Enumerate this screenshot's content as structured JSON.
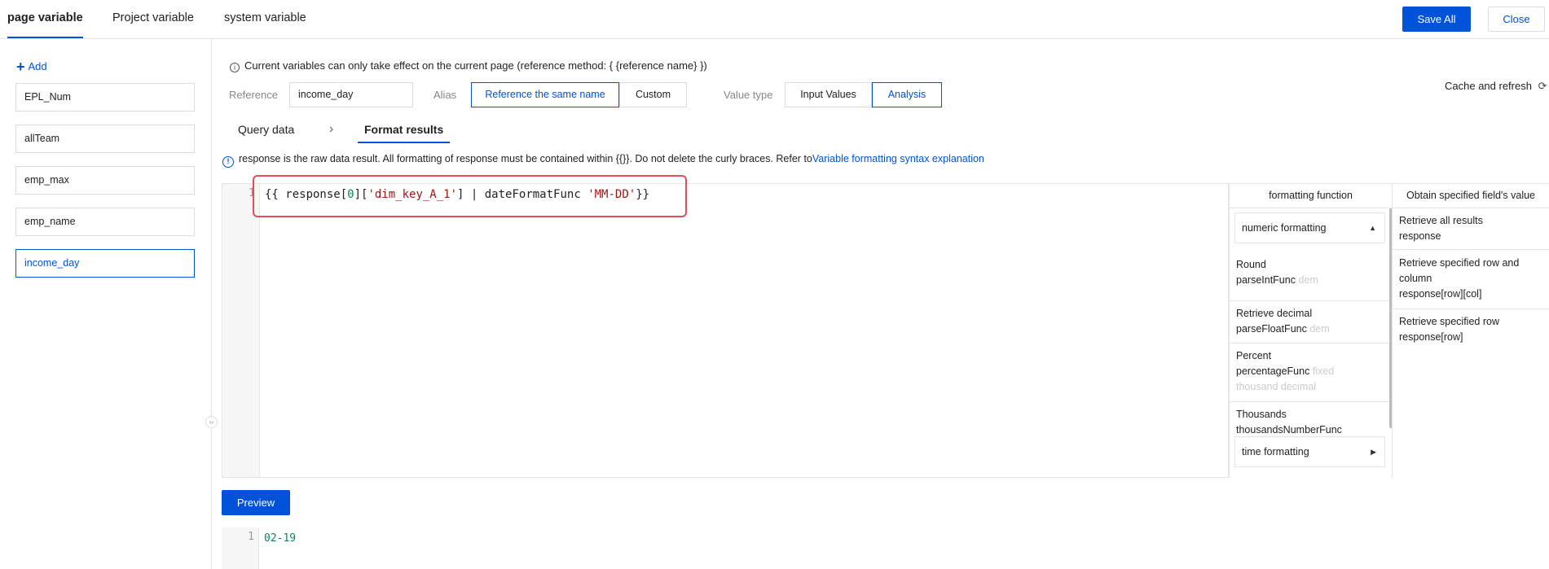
{
  "tabs": {
    "page": "page variable",
    "project": "Project variable",
    "system": "system variable"
  },
  "actions": {
    "save_all": "Save All",
    "close": "Close"
  },
  "sidebar": {
    "add_label": "Add",
    "variables": [
      "EPL_Num",
      "allTeam",
      "emp_max",
      "emp_name",
      "income_day"
    ],
    "selected": "income_day"
  },
  "info": "Current variables can only take effect on the current page (reference method: { {reference name} })",
  "form": {
    "reference_label": "Reference",
    "reference_value": "income_day",
    "alias_label": "Alias",
    "alias_options": [
      "Reference the same name",
      "Custom"
    ],
    "value_type_label": "Value type",
    "value_type_options": [
      "Input Values",
      "Analysis"
    ],
    "cache_refresh": "Cache and refresh"
  },
  "subtabs": {
    "query": "Query data",
    "format": "Format results"
  },
  "notice": {
    "text": "response is the raw data result. All formatting of response must be contained within {{}}. Do not delete the curly braces. Refer to",
    "link": "Variable formatting syntax explanation"
  },
  "editor": {
    "line_number": "1",
    "code": {
      "p1": "{{ response[",
      "n1": "0",
      "p2": "][",
      "s1": "'dim_key_A_1'",
      "p3": "] | dateFormatFunc ",
      "s2": "'MM-DD'",
      "p4": "}}"
    }
  },
  "format_panel": {
    "title": "formatting function",
    "numeric_dropdown": "numeric formatting",
    "time_dropdown": "time formatting",
    "functions": [
      {
        "name": "Round",
        "func": "parseIntFunc",
        "hint": "dem"
      },
      {
        "name": "Retrieve decimal",
        "func": "parseFloatFunc",
        "hint": "dem"
      },
      {
        "name": "Percent",
        "func": "percentageFunc",
        "hint": "fixed",
        "hint2": "thousand decimal"
      },
      {
        "name": "Thousands",
        "func": "thousandsNumberFunc",
        "hint": ""
      }
    ]
  },
  "value_panel": {
    "title": "Obtain specified field's value",
    "items": [
      {
        "l1": "Retrieve all results",
        "l2": "response"
      },
      {
        "l1": "Retrieve specified row and",
        "l2": "column",
        "l3": "response[row][col]"
      },
      {
        "l1": "Retrieve specified row",
        "l2": "response[row]"
      }
    ]
  },
  "preview": {
    "button": "Preview",
    "line_number": "1",
    "result": "02-19"
  },
  "colors": {
    "accent": "#0052d9",
    "highlight_box": "#e34d59"
  }
}
